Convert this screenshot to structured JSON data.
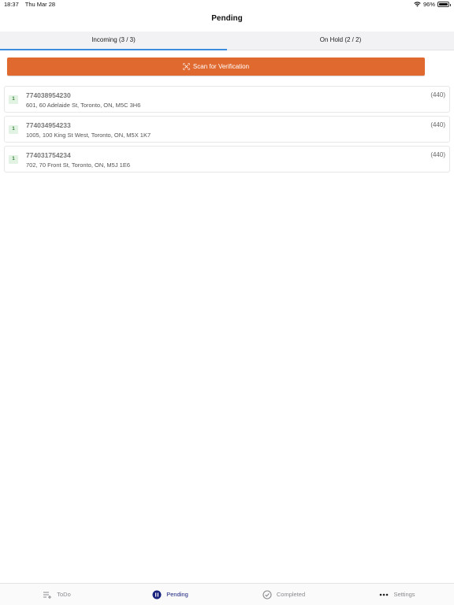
{
  "status_bar": {
    "time": "18:37",
    "date": "Thu Mar 28",
    "battery": "96%",
    "battery_level": 0.96
  },
  "nav": {
    "title": "Pending"
  },
  "tabs": [
    {
      "label": "Incoming (3 / 3)",
      "active": true
    },
    {
      "label": "On Hold (2 / 2)",
      "active": false
    }
  ],
  "scan_button": {
    "label": "Scan for Verification",
    "icon": "barcode-scan-icon"
  },
  "items": [
    {
      "badge": "1",
      "id": "774038954230",
      "address": "601, 60 Adelaide St, Toronto, ON, M5C 3H6",
      "code": "(440)"
    },
    {
      "badge": "1",
      "id": "774034954233",
      "address": "1005, 100 King St West, Toronto, ON, M5X 1K7",
      "code": "(440)"
    },
    {
      "badge": "1",
      "id": "774031754234",
      "address": "702, 70 Front St, Toronto, ON, M5J 1E6",
      "code": "(440)"
    }
  ],
  "tabbar": [
    {
      "label": "ToDo",
      "icon": "list-add-icon",
      "active": false
    },
    {
      "label": "Pending",
      "icon": "pause-circle-icon",
      "active": true
    },
    {
      "label": "Completed",
      "icon": "check-circle-icon",
      "active": false
    },
    {
      "label": "Settings",
      "icon": "more-dots-icon",
      "active": false
    }
  ],
  "colors": {
    "accent": "#e0692f",
    "tab_indicator": "#3d8ddf",
    "active_tab": "#1a237e",
    "badge_bg": "#e3f3e3"
  }
}
